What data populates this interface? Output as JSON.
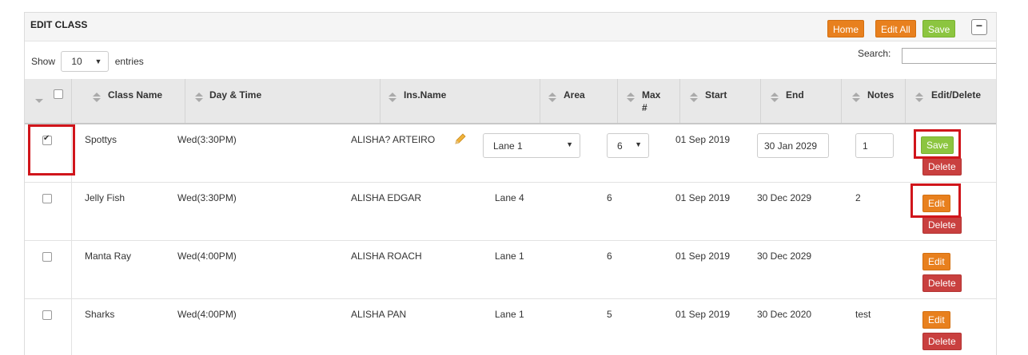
{
  "panel": {
    "title": "EDIT CLASS",
    "buttons": {
      "home": "Home",
      "edit_all": "Edit All",
      "save": "Save",
      "collapse": "−"
    }
  },
  "controls": {
    "show_label": "Show",
    "page_length": "10",
    "entries_label": "entries",
    "search_label": "Search:",
    "search_value": ""
  },
  "columns": [
    "Class Name",
    "Day & Time",
    "Ins.Name",
    "Area",
    "Max",
    "#",
    "Start",
    "End",
    "Notes",
    "Edit/Delete"
  ],
  "rows": [
    {
      "checked": true,
      "class_name": "Spottys",
      "day_time": "Wed(3:30PM)",
      "ins_name": "ALISHA? ARTEIRO",
      "area": "Lane 1",
      "max": "6",
      "start": "01 Sep 2019",
      "end": "30 Jan 2029",
      "notes": "1",
      "action": "Save",
      "delete": "Delete",
      "editing": true
    },
    {
      "checked": false,
      "class_name": "Jelly Fish",
      "day_time": "Wed(3:30PM)",
      "ins_name": "ALISHA EDGAR",
      "area": "Lane 4",
      "max": "6",
      "start": "01 Sep 2019",
      "end": "30 Dec 2029",
      "notes": "2",
      "action": "Edit",
      "delete": "Delete",
      "editing": false
    },
    {
      "checked": false,
      "class_name": "Manta Ray",
      "day_time": "Wed(4:00PM)",
      "ins_name": "ALISHA ROACH",
      "area": "Lane 1",
      "max": "6",
      "start": "01 Sep 2019",
      "end": "30 Dec 2029",
      "notes": "",
      "action": "Edit",
      "delete": "Delete",
      "editing": false
    },
    {
      "checked": false,
      "class_name": "Sharks",
      "day_time": "Wed(4:00PM)",
      "ins_name": "ALISHA PAN",
      "area": "Lane 1",
      "max": "5",
      "start": "01 Sep 2019",
      "end": "30 Dec 2020",
      "notes": "test",
      "action": "Edit",
      "delete": "Delete",
      "editing": false
    }
  ],
  "colors": {
    "orange": "#e8801e",
    "green": "#8cc540",
    "red": "#c9403f",
    "highlight": "#d0151b"
  }
}
